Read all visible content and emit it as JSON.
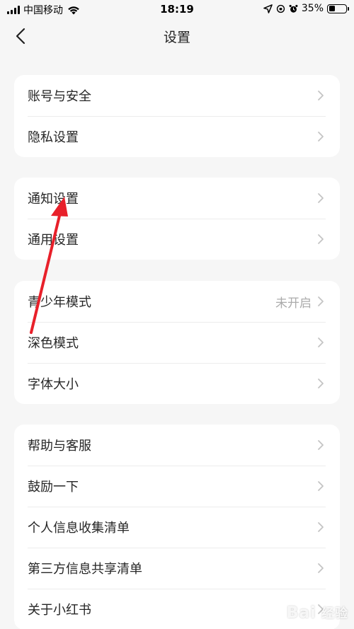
{
  "status_bar": {
    "carrier": "中国移动",
    "time": "18:19",
    "battery": "35%",
    "battery_level": 0.35
  },
  "nav": {
    "title": "设置",
    "back_icon": "chevron-left-icon"
  },
  "groups": [
    {
      "items": [
        {
          "label": "账号与安全",
          "value": ""
        },
        {
          "label": "隐私设置",
          "value": ""
        }
      ]
    },
    {
      "items": [
        {
          "label": "通知设置",
          "value": ""
        },
        {
          "label": "通用设置",
          "value": ""
        }
      ]
    },
    {
      "items": [
        {
          "label": "青少年模式",
          "value": "未开启"
        },
        {
          "label": "深色模式",
          "value": ""
        },
        {
          "label": "字体大小",
          "value": ""
        }
      ]
    },
    {
      "items": [
        {
          "label": "帮助与客服",
          "value": ""
        },
        {
          "label": "鼓励一下",
          "value": ""
        },
        {
          "label": "个人信息收集清单",
          "value": ""
        },
        {
          "label": "第三方信息共享清单",
          "value": ""
        },
        {
          "label": "关于小红书",
          "value": ""
        }
      ]
    }
  ],
  "annotation": {
    "arrow_color": "#e8202a"
  },
  "watermark": "Bai 经验"
}
